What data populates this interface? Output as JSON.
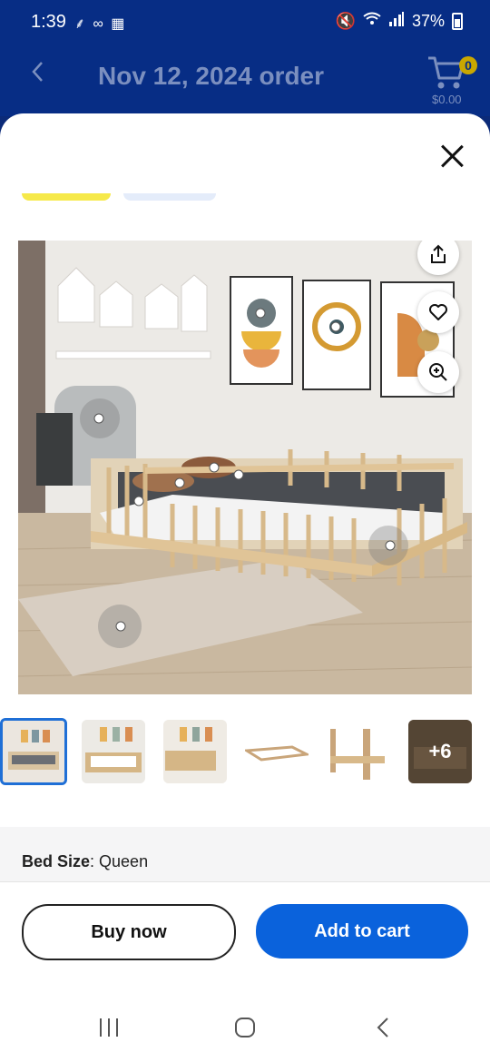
{
  "status_bar": {
    "time": "1:39",
    "left_icons": "⸙ ∞ ▦",
    "battery_text": "37%"
  },
  "header": {
    "title": "Nov 12, 2024 order",
    "cart_count": "0",
    "cart_total": "$0.00"
  },
  "product": {
    "image_icons": [
      "share-icon",
      "heart-icon",
      "zoom-icon"
    ],
    "thumbnails": [
      {
        "label": ""
      },
      {
        "label": ""
      },
      {
        "label": ""
      },
      {
        "label": ""
      },
      {
        "label": ""
      },
      {
        "label": "+6"
      }
    ]
  },
  "options": {
    "bed_size_label": "Bed Size",
    "bed_size_value": ": Queen"
  },
  "actions": {
    "buy_now": "Buy now",
    "add_to_cart": "Add to cart"
  },
  "colors": {
    "brand_blue": "#072d85",
    "button_blue": "#0a62dc",
    "pill_yellow": "#f6e94a"
  }
}
